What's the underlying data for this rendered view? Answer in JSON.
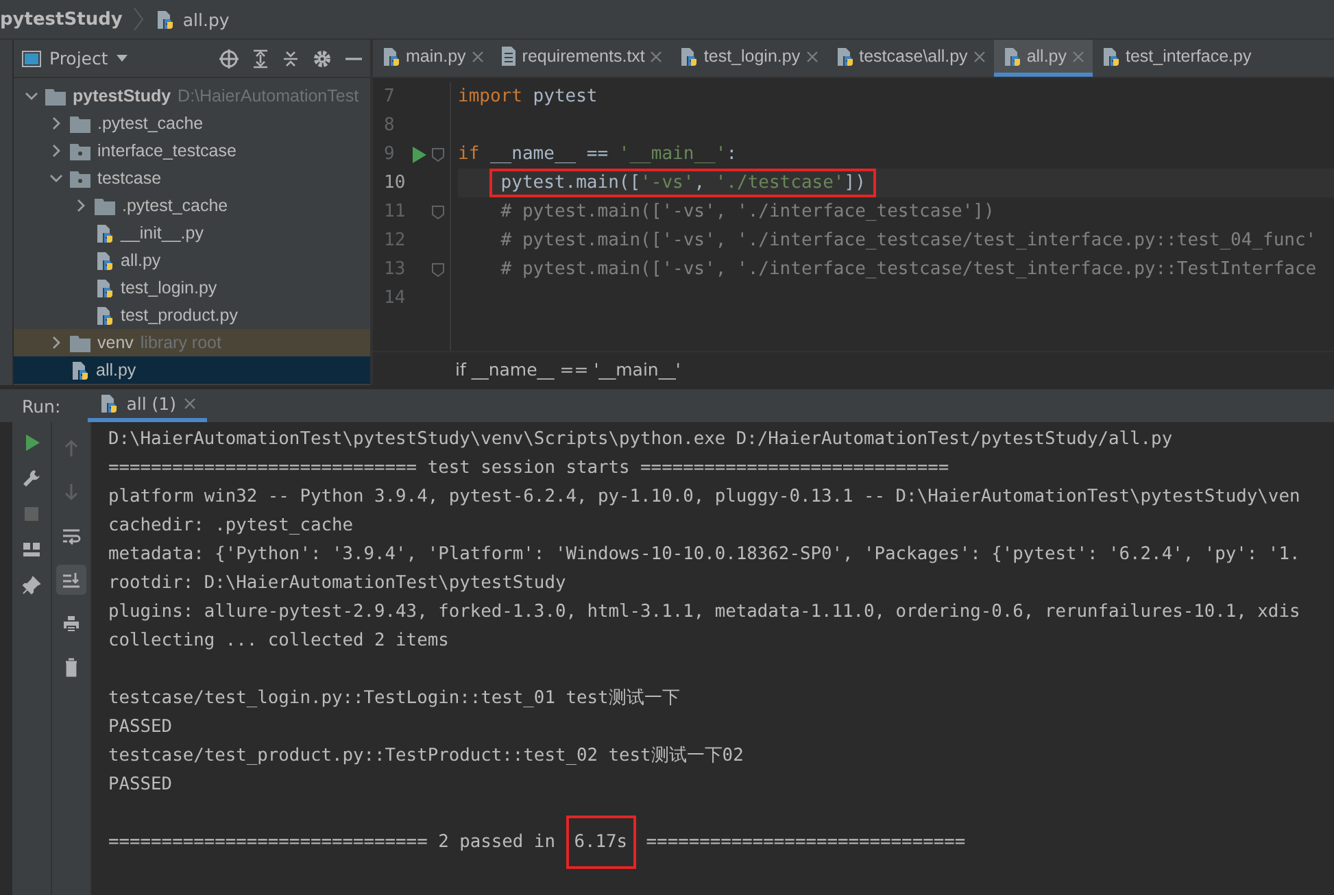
{
  "breadcrumb": {
    "project": "pytestStudy",
    "file": "all.py"
  },
  "project_panel": {
    "title": "Project",
    "tree": [
      {
        "label": "pytestStudy",
        "hint": "D:\\HaierAutomationTest",
        "kind": "folder",
        "expanded": true,
        "selected": false,
        "children": [
          {
            "label": ".pytest_cache",
            "kind": "folder",
            "expanded": false,
            "selected": false
          },
          {
            "label": "interface_testcase",
            "kind": "package",
            "expanded": false,
            "selected": false
          },
          {
            "label": "testcase",
            "kind": "package",
            "expanded": true,
            "selected": false,
            "children": [
              {
                "label": ".pytest_cache",
                "kind": "folder",
                "expanded": false,
                "selected": false
              },
              {
                "label": "__init__.py",
                "kind": "python",
                "selected": false
              },
              {
                "label": "all.py",
                "kind": "python",
                "selected": false
              },
              {
                "label": "test_login.py",
                "kind": "python",
                "selected": false
              },
              {
                "label": "test_product.py",
                "kind": "python",
                "selected": false
              }
            ]
          },
          {
            "label": "venv",
            "hint": "library root",
            "kind": "library",
            "expanded": false,
            "selected": false
          },
          {
            "label": "all.py",
            "kind": "python",
            "selected": true
          }
        ]
      }
    ]
  },
  "editor": {
    "tabs": [
      {
        "label": "main.py",
        "kind": "python",
        "selected": false
      },
      {
        "label": "requirements.txt",
        "kind": "text",
        "selected": false
      },
      {
        "label": "test_login.py",
        "kind": "python",
        "selected": false
      },
      {
        "label": "testcase\\all.py",
        "kind": "python",
        "selected": false
      },
      {
        "label": "all.py",
        "kind": "python",
        "selected": true
      },
      {
        "label": "test_interface.py",
        "kind": "python",
        "selected": false
      }
    ],
    "lines": [
      {
        "number": "7",
        "current": false,
        "runnable": false,
        "tokens": [
          {
            "kind": "kw",
            "text": "import"
          },
          {
            "kind": "plain",
            "text": " pytest"
          }
        ]
      },
      {
        "number": "8",
        "current": false,
        "runnable": false
      },
      {
        "number": "9",
        "current": false,
        "runnable": true,
        "tokens": [
          {
            "kind": "kw",
            "text": "if"
          },
          {
            "kind": "plain",
            "text": " __name__ == "
          },
          {
            "kind": "str",
            "text": "'__main__'"
          },
          {
            "kind": "plain",
            "text": ":"
          }
        ]
      },
      {
        "number": "10",
        "current": true,
        "runnable": false,
        "boxed": true,
        "tokens": [
          {
            "kind": "plain",
            "text": "pytest.main(["
          },
          {
            "kind": "str",
            "text": "'-vs'"
          },
          {
            "kind": "plain",
            "text": ", "
          },
          {
            "kind": "str",
            "text": "'./testcase'"
          },
          {
            "kind": "plain",
            "text": "])"
          }
        ]
      },
      {
        "number": "11",
        "current": false,
        "runnable": false,
        "tokens": [
          {
            "kind": "comment",
            "text": "    # pytest.main(['-vs', './interface_testcase'])"
          }
        ]
      },
      {
        "number": "12",
        "current": false,
        "runnable": false,
        "tokens": [
          {
            "kind": "comment",
            "text": "    # pytest.main(['-vs', './interface_testcase/test_interface.py::test_04_func'"
          }
        ]
      },
      {
        "number": "13",
        "current": false,
        "runnable": false,
        "tokens": [
          {
            "kind": "comment",
            "text": "    # pytest.main(['-vs', './interface_testcase/test_interface.py::TestInterface"
          }
        ]
      },
      {
        "number": "14",
        "current": false,
        "runnable": false
      }
    ],
    "footer": "if __name__ == '__main__'"
  },
  "run": {
    "label": "Run:",
    "tabs": [
      {
        "label": "all (1)",
        "selected": true
      }
    ],
    "console": [
      {
        "kind": "text",
        "text": "D:\\HaierAutomationTest\\pytestStudy\\venv\\Scripts\\python.exe D:/HaierAutomationTest/pytestStudy/all.py"
      },
      {
        "kind": "text",
        "text": "============================= test session starts ============================="
      },
      {
        "kind": "text",
        "text": "platform win32 -- Python 3.9.4, pytest-6.2.4, py-1.10.0, pluggy-0.13.1 -- D:\\HaierAutomationTest\\pytestStudy\\ven"
      },
      {
        "kind": "text",
        "text": "cachedir: .pytest_cache"
      },
      {
        "kind": "text",
        "text": "metadata: {'Python': '3.9.4', 'Platform': 'Windows-10-10.0.18362-SP0', 'Packages': {'pytest': '6.2.4', 'py': '1."
      },
      {
        "kind": "text",
        "text": "rootdir: D:\\HaierAutomationTest\\pytestStudy"
      },
      {
        "kind": "text",
        "text": "plugins: allure-pytest-2.9.43, forked-1.3.0, html-3.1.1, metadata-1.11.0, ordering-0.6, rerunfailures-10.1, xdis"
      },
      {
        "kind": "text",
        "text": "collecting ... collected 2 items"
      },
      {
        "kind": "blank"
      },
      {
        "kind": "text",
        "text": "testcase/test_login.py::TestLogin::test_01 test测试一下"
      },
      {
        "kind": "text",
        "text": "PASSED"
      },
      {
        "kind": "text",
        "text": "testcase/test_product.py::TestProduct::test_02 test测试一下02"
      },
      {
        "kind": "text",
        "text": "PASSED"
      },
      {
        "kind": "blank"
      },
      {
        "kind": "tokens",
        "tokens": [
          {
            "text": "============================== 2 passed in ",
            "boxed": false
          },
          {
            "text": "6.17s",
            "boxed": true
          },
          {
            "text": " ==============================",
            "boxed": false
          }
        ]
      },
      {
        "kind": "blank"
      }
    ]
  }
}
